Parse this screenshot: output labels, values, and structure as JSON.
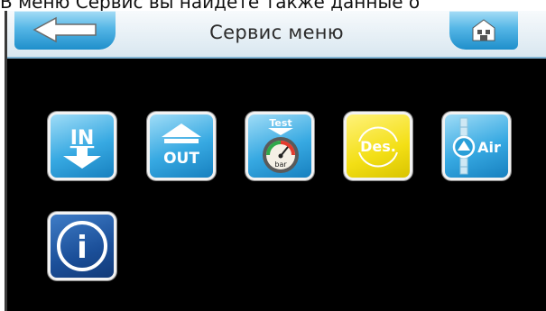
{
  "caption": "В меню Сервис вы найдете также данные о",
  "header": {
    "title": "Сервис меню"
  },
  "tiles": [
    {
      "label": "IN"
    },
    {
      "label": "OUT"
    },
    {
      "label": "Test",
      "sublabel": "bar"
    },
    {
      "label": "Des."
    },
    {
      "label": "Air"
    },
    {
      "label": "i"
    }
  ],
  "colors": {
    "accent": "#2a9fd8",
    "screen_background": "#000000",
    "des_tile": "#f3df15",
    "info_tile": "#1b4f99"
  },
  "icons": [
    "back-arrow-icon",
    "home-icon",
    "arrow-down-icon",
    "arrow-up-icon",
    "pressure-gauge-icon",
    "disinfection-icon",
    "air-vent-icon",
    "info-icon"
  ]
}
